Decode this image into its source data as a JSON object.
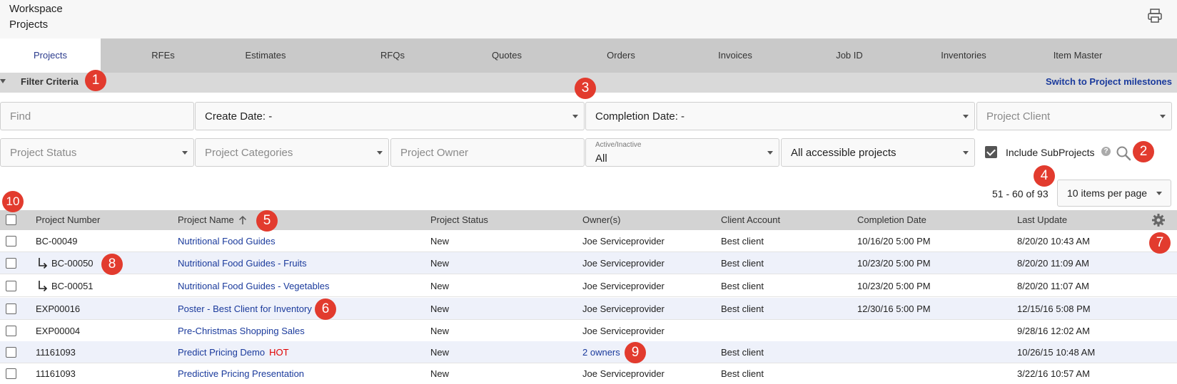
{
  "header": {
    "title_line1": "Workspace",
    "title_line2": "Projects"
  },
  "tabs": [
    {
      "label": "Projects"
    },
    {
      "label": "RFEs"
    },
    {
      "label": "Estimates"
    },
    {
      "label": "RFQs"
    },
    {
      "label": "Quotes"
    },
    {
      "label": "Orders"
    },
    {
      "label": "Invoices"
    },
    {
      "label": "Job ID"
    },
    {
      "label": "Inventories"
    },
    {
      "label": "Item Master"
    }
  ],
  "filter": {
    "label": "Filter Criteria",
    "switch_link": "Switch to Project milestones",
    "find_placeholder": "Find",
    "create_date": "Create Date: -",
    "completion_date": "Completion Date: -",
    "project_client_placeholder": "Project Client",
    "project_status_placeholder": "Project Status",
    "project_categories_placeholder": "Project Categories",
    "project_owner_placeholder": "Project Owner",
    "active_label": "Active/Inactive",
    "active_value": "All",
    "scope_value": "All accessible projects",
    "include_subprojects": "Include SubProjects",
    "include_checked": true
  },
  "pager": {
    "range_text": "51 - 60 of 93",
    "per_page": "10 items per page"
  },
  "columns": {
    "number": "Project Number",
    "name": "Project Name",
    "status": "Project Status",
    "owners": "Owner(s)",
    "client": "Client Account",
    "completion": "Completion Date",
    "updated": "Last Update"
  },
  "rows": [
    {
      "number": "BC-00049",
      "name": "Nutritional Food Guides",
      "status": "New",
      "owner": "Joe Serviceprovider",
      "client": "Best client",
      "completion": "10/16/20 5:00 PM",
      "updated": "8/20/20 10:43 AM",
      "hot": "",
      "sub": false
    },
    {
      "number": "BC-00050",
      "name": "Nutritional Food Guides - Fruits",
      "status": "New",
      "owner": "Joe Serviceprovider",
      "client": "Best client",
      "completion": "10/23/20 5:00 PM",
      "updated": "8/20/20 11:09 AM",
      "hot": "",
      "sub": true
    },
    {
      "number": "BC-00051",
      "name": "Nutritional Food Guides - Vegetables",
      "status": "New",
      "owner": "Joe Serviceprovider",
      "client": "Best client",
      "completion": "10/23/20 5:00 PM",
      "updated": "8/20/20 11:07 AM",
      "hot": "",
      "sub": true
    },
    {
      "number": "EXP00016",
      "name": "Poster - Best Client for Inventory",
      "status": "New",
      "owner": "Joe Serviceprovider",
      "client": "Best client",
      "completion": "12/30/16 5:00 PM",
      "updated": "12/15/16 5:08 PM",
      "hot": "",
      "sub": false
    },
    {
      "number": "EXP00004",
      "name": "Pre-Christmas Shopping Sales",
      "status": "New",
      "owner": "Joe Serviceprovider",
      "client": "",
      "completion": "",
      "updated": "9/28/16 12:02 AM",
      "hot": "",
      "sub": false
    },
    {
      "number": "11161093",
      "name": "Predict Pricing Demo",
      "status": "New",
      "owner": "2 owners",
      "client": "Best client",
      "completion": "",
      "updated": "10/26/15 10:48 AM",
      "hot": "HOT",
      "sub": false
    },
    {
      "number": "11161093",
      "name": "Predictive Pricing Presentation",
      "status": "New",
      "owner": "Joe Serviceprovider",
      "client": "Best client",
      "completion": "",
      "updated": "3/22/16 10:57 AM",
      "hot": "",
      "sub": false
    }
  ],
  "callouts": [
    "1",
    "2",
    "3",
    "4",
    "5",
    "6",
    "7",
    "8",
    "9",
    "10"
  ],
  "colors": {
    "accent": "#1a3a9c",
    "badge": "#e23b2e",
    "hot": "#e00000",
    "row_alt": "#eef1fa"
  }
}
